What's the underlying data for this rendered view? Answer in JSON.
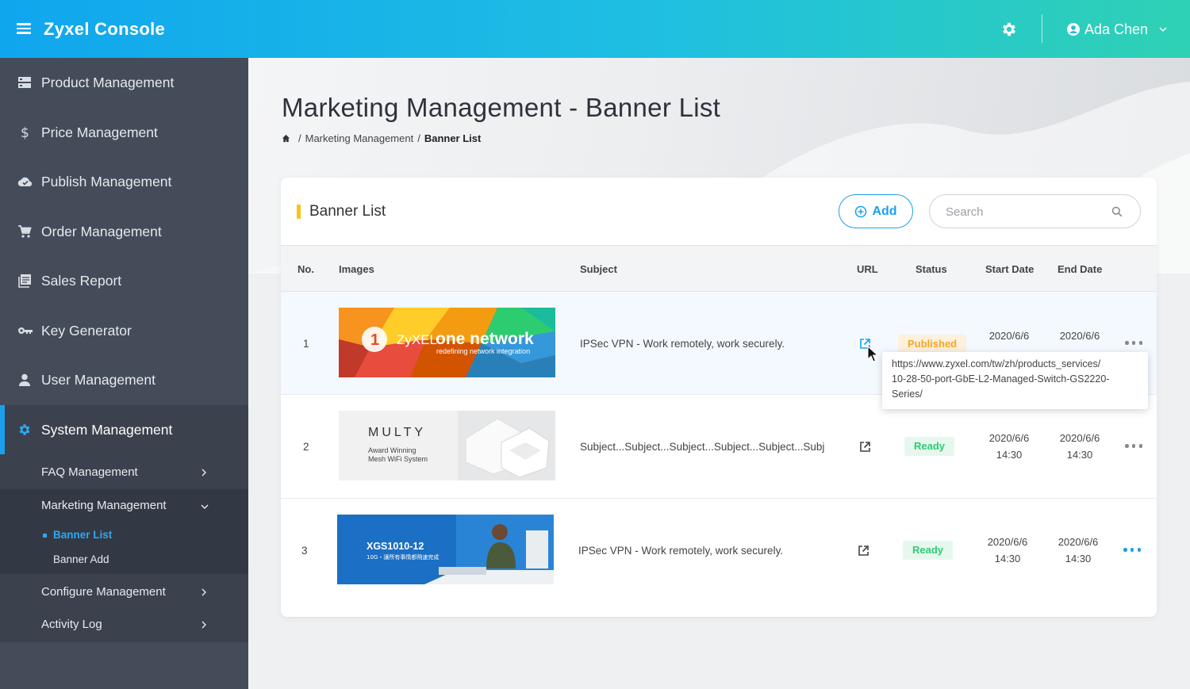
{
  "app": {
    "title": "Zyxel Console",
    "user": "Ada Chen"
  },
  "sidebar": {
    "items": [
      {
        "label": "Product Management",
        "icon": "server-icon"
      },
      {
        "label": "Price Management",
        "icon": "dollar-icon"
      },
      {
        "label": "Publish Management",
        "icon": "cloud-check-icon"
      },
      {
        "label": "Order Management",
        "icon": "cart-icon"
      },
      {
        "label": "Sales Report",
        "icon": "report-icon"
      },
      {
        "label": "Key Generator",
        "icon": "key-icon"
      },
      {
        "label": "User Management",
        "icon": "user-icon"
      },
      {
        "label": "System Management",
        "icon": "gear-icon"
      }
    ],
    "sub_items": [
      {
        "label": "FAQ Management"
      },
      {
        "label": "Marketing Management"
      },
      {
        "label": "Configure Management"
      },
      {
        "label": "Activity Log"
      }
    ],
    "marketing_children": [
      {
        "label": "Banner List"
      },
      {
        "label": "Banner Add"
      }
    ]
  },
  "page": {
    "title": "Marketing Management - Banner List",
    "breadcrumb": [
      "Marketing Management",
      "Banner List"
    ]
  },
  "card": {
    "title": "Banner List",
    "add_label": "Add",
    "search_placeholder": "Search"
  },
  "table": {
    "headers": [
      "No.",
      "Images",
      "Subject",
      "URL",
      "Status",
      "Start Date",
      "End Date"
    ],
    "rows": [
      {
        "no": "1",
        "subject": "IPSec VPN - Work remotely, work securely.",
        "status": "Published",
        "start_date": "2020/6/6",
        "end_date": "2020/6/6",
        "image": {
          "brand_number": "1",
          "brand_text": "ZyXEL",
          "headline": "one network",
          "tagline": "redefining network integration"
        }
      },
      {
        "no": "2",
        "subject": "Subject...Subject...Subject...Subject...Subject...Subj",
        "status": "Ready",
        "start_date": "2020/6/6",
        "start_time": "14:30",
        "end_date": "2020/6/6",
        "end_time": "14:30",
        "image": {
          "headline": "MULTY",
          "tagline_1": "Award Winning",
          "tagline_2": "Mesh WiFi System"
        }
      },
      {
        "no": "3",
        "subject": "IPSec VPN - Work remotely, work securely.",
        "status": "Ready",
        "start_date": "2020/6/6",
        "start_time": "14:30",
        "end_date": "2020/6/6",
        "end_time": "14:30",
        "image": {
          "headline": "XGS1010-12",
          "tagline": "10G・讓所有事情都飛速完成"
        }
      }
    ]
  },
  "tooltip": {
    "url": "https://www.zyxel.com/tw/zh/products_services/10-28-50-port-GbE-L2-Managed-Switch-GS2220-Series/",
    "lines": [
      "https://www.zyxel.com/tw/zh/products_services/",
      "10-28-50-port-GbE-L2-Managed-Switch-GS2220-",
      "Series/"
    ]
  },
  "colors": {
    "accent": "#1aa0ea",
    "published": "#f5a623",
    "ready": "#2ecc71",
    "sidebar": "#454c59",
    "title_bar_accent": "#f9c31c"
  }
}
